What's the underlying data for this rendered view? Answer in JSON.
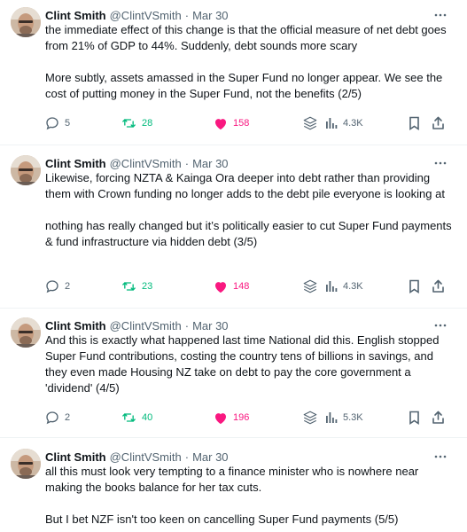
{
  "author": {
    "name": "Clint Smith",
    "handle": "@ClintVSmith",
    "separator": "·",
    "date": "Mar 30"
  },
  "icons": {
    "more": "more-horizontal-icon",
    "reply": "reply-icon",
    "retweet": "retweet-icon",
    "like": "heart-icon",
    "grok": "grok-icon",
    "views": "views-bar-chart-icon",
    "bookmark": "bookmark-icon",
    "share": "share-icon"
  },
  "colors": {
    "retweet_active": "#00ba7c",
    "like_active": "#f91880",
    "muted": "#536471"
  },
  "tweets": [
    {
      "paragraphs": [
        "the immediate effect of this change is that the official measure of net debt goes from 21% of GDP to 44%. Suddenly, debt sounds more scary",
        "More subtly, assets amassed in the Super Fund no longer appear. We see the cost of putting money in the Super Fund, not the benefits (2/5)"
      ],
      "replies": "5",
      "retweets": "28",
      "likes": "158",
      "views": "4.3K"
    },
    {
      "paragraphs": [
        "Likewise, forcing NZTA & Kainga Ora deeper into debt rather than providing them with Crown funding no longer adds to the debt pile everyone is looking at",
        "nothing has really changed but it’s politically easier to cut Super Fund payments & fund infrastructure via hidden debt (3/5)"
      ],
      "replies": "2",
      "retweets": "23",
      "likes": "148",
      "views": "4.3K"
    },
    {
      "paragraphs": [
        "And this is exactly what happened last time National did this. English stopped Super Fund contributions, costing the country tens of billions in savings, and they even made Housing NZ take on debt to pay the core government a 'dividend' (4/5)"
      ],
      "replies": "2",
      "retweets": "40",
      "likes": "196",
      "views": "5.3K"
    },
    {
      "paragraphs": [
        "all this must look very tempting to a finance minister who is nowhere near making the books balance for her tax cuts.",
        "But I bet NZF isn't too keen on cancelling Super Fund payments (5/5)"
      ]
    }
  ]
}
